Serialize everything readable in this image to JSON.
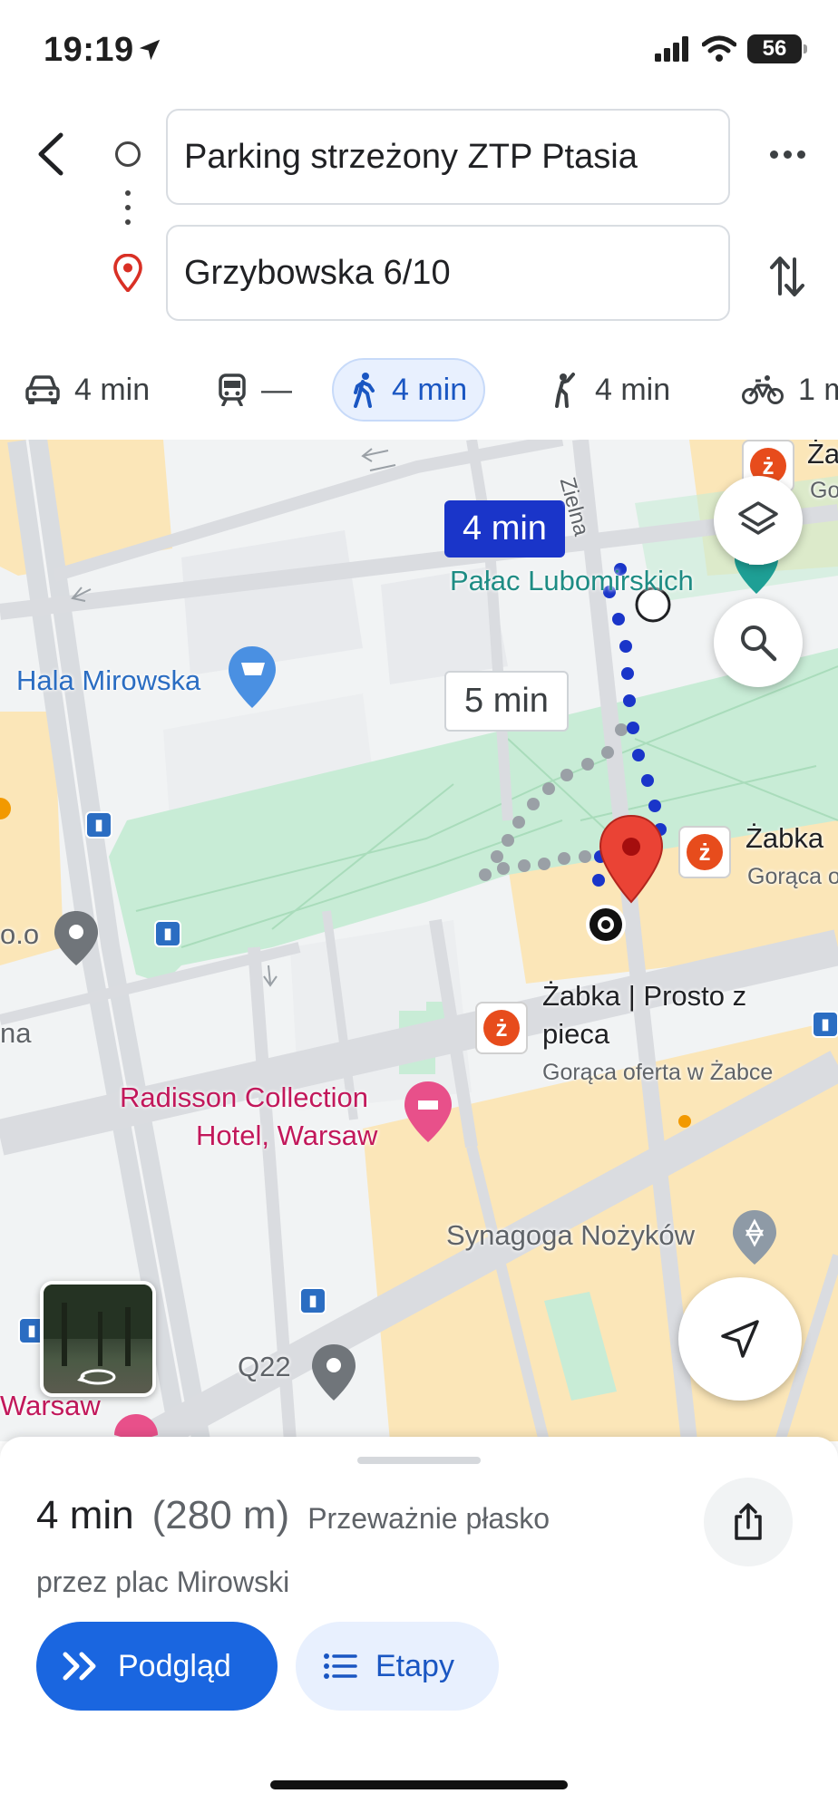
{
  "status_bar": {
    "time": "19:19",
    "battery": "56"
  },
  "route": {
    "origin": "Parking strzeżony ZTP Ptasia",
    "destination": "Grzybowska 6/10"
  },
  "modes": [
    {
      "id": "car",
      "icon": "car-icon",
      "label": "4 min"
    },
    {
      "id": "transit",
      "icon": "train-icon",
      "label": "—"
    },
    {
      "id": "walk",
      "icon": "walking-icon",
      "label": "4 min",
      "selected": true
    },
    {
      "id": "ride",
      "icon": "ride-hailing-icon",
      "label": "4 min"
    },
    {
      "id": "bike",
      "icon": "bike-icon",
      "label": "1 m"
    }
  ],
  "map": {
    "bubble_primary": "4 min",
    "bubble_alt": "5 min",
    "places": {
      "palac": "Pałac Lubomirskich",
      "hala": "Hala Mirowska",
      "zabka_right": "Żabka",
      "zabka_right_sub": "Gorąca o",
      "zabka_top": "Ża",
      "zabka_top_sub": "Go",
      "zabka_center_line1": "Żabka | Prosto z",
      "zabka_center_line2": "pieca",
      "zabka_center_sub": "Gorąca oferta w Żabce",
      "radisson_line1": "Radisson Collection",
      "radisson_line2": "Hotel, Warsaw",
      "synagoga": "Synagoga Nożyków",
      "q22": "Q22",
      "warsaw": "Warsaw",
      "oo": "o.o",
      "na": "na",
      "ziena": "Zielna"
    },
    "colors": {
      "route": "#1a35c9",
      "alt_route": "#9aa0a6",
      "park": "#c8ecd6",
      "building": "#fbe6b8"
    }
  },
  "summary": {
    "duration": "4 min",
    "distance": "(280 m)",
    "terrain": "Przeważnie płasko",
    "via": "przez plac Mirowski"
  },
  "buttons": {
    "preview": "Podgląd",
    "steps": "Etapy"
  }
}
